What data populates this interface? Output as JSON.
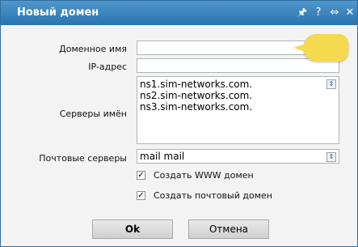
{
  "window": {
    "title": "Новый домен",
    "buttons": {
      "pin_icon": "🖈",
      "help_icon": "?",
      "resize_icon": "⇔",
      "close_icon": "✕"
    }
  },
  "form": {
    "domain_label": "Доменное имя",
    "domain_value": "",
    "ip_label": "IP-адрес",
    "ip_value": "",
    "ns_label": "Серверы имён",
    "ns_lines": [
      "ns1.sim-networks.com.",
      "ns2.sim-networks.com.",
      "ns3.sim-networks.com."
    ],
    "mail_label": "Почтовые серверы",
    "mail_value": "mail mail",
    "checkbox_www": "Создать WWW домен",
    "checkbox_mail": "Создать почтовый домен"
  },
  "buttons": {
    "ok": "Ok",
    "cancel": "Отмена"
  },
  "colors": {
    "titlebar": "#2a73ad",
    "tooltip": "#f5d94f"
  }
}
